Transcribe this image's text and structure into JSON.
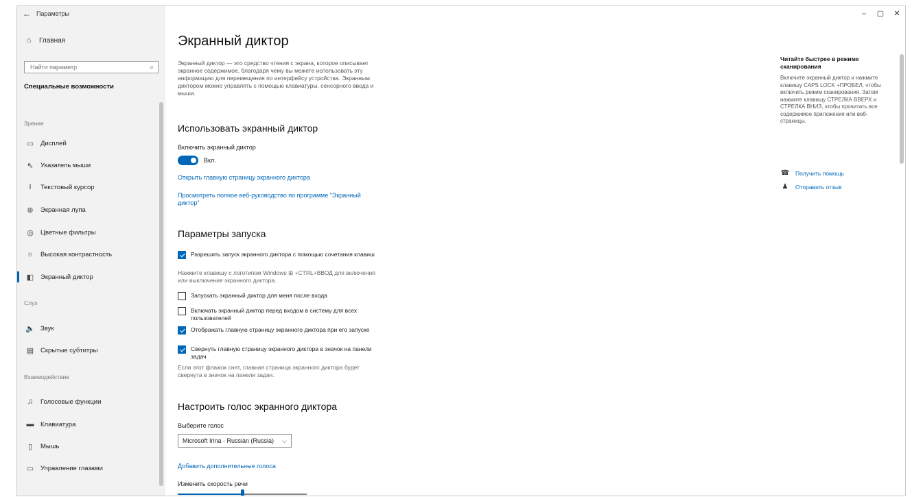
{
  "window": {
    "title": "Параметры",
    "back_icon": "←",
    "minimize": "–",
    "maximize": "▢",
    "close": "✕"
  },
  "sidebar": {
    "home_label": "Главная",
    "search_placeholder": "Найти параметр",
    "section_title": "Специальные возможности",
    "groups": [
      "Зрение",
      "Слух",
      "Взаимодействие"
    ],
    "items": [
      {
        "label": "Дисплей",
        "icon": "display-icon"
      },
      {
        "label": "Указатель мыши",
        "icon": "mouse-pointer-icon"
      },
      {
        "label": "Текстовый курсор",
        "icon": "text-cursor-icon"
      },
      {
        "label": "Экранная лупа",
        "icon": "magnifier-icon"
      },
      {
        "label": "Цветные фильтры",
        "icon": "color-filter-icon"
      },
      {
        "label": "Высокая контрастность",
        "icon": "contrast-icon"
      },
      {
        "label": "Экранный диктор",
        "icon": "narrator-icon"
      },
      {
        "label": "Звук",
        "icon": "speaker-icon"
      },
      {
        "label": "Скрытые субтитры",
        "icon": "captions-icon"
      },
      {
        "label": "Голосовые функции",
        "icon": "microphone-icon"
      },
      {
        "label": "Клавиатура",
        "icon": "keyboard-icon"
      },
      {
        "label": "Мышь",
        "icon": "mouse-icon"
      },
      {
        "label": "Управление глазами",
        "icon": "eye-control-icon"
      }
    ]
  },
  "main": {
    "title": "Экранный диктор",
    "description": "Экранный диктор — это средство чтения с экрана, которое описывает экранное содержимое, благодаря чему вы можете использовать эту информацию для перемещения по интерфейсу устройства. Экранным диктором можно управлять с помощью клавиатуры, сенсорного ввода и мыши.",
    "use_heading": "Использовать экранный диктор",
    "toggle_label": "Включить экранный диктор",
    "toggle_state": "Вкл.",
    "link_home": "Открыть главную страницу экранного диктора",
    "link_guide": "Просмотреть полное веб-руководство по программе \"Экранный диктор\"",
    "startup_heading": "Параметры запуска",
    "checkboxes": [
      {
        "label": "Разрешить запуск экранного диктора с помощью сочетания клавиш",
        "checked": true
      },
      {
        "label": "Запускать экранный диктор для меня после входа",
        "checked": false
      },
      {
        "label": "Включать экранный диктор перед входом в систему для всех пользователей",
        "checked": false
      },
      {
        "label": "Отображать главную страницу экранного диктора при его запуске",
        "checked": true
      },
      {
        "label": "Свернуть главную страницу экранного диктора в значок на панели задач",
        "checked": true
      }
    ],
    "hint_shortcut": "Нажмите клавишу с логотипом Windows ⊞ +CTRL+ВВОД для включения или выключения экранного диктора.",
    "hint_minimize": "Если этот флажок снят, главная страница экранного диктора будет свернута в значок на панели задач.",
    "voice_heading": "Настроить голос экранного диктора",
    "voice_label": "Выберите голос",
    "voice_value": "Microsoft Irina - Russian (Russia)",
    "link_add_voices": "Добавить дополнительные голоса",
    "speed_label": "Изменить скорость речи",
    "speed_value": 0.5
  },
  "aside": {
    "title": "Читайте быстрее в режиме сканирования",
    "text": "Включите экранный диктор и нажмите клавишу CAPS LOCK +ПРОБЕЛ, чтобы включить режим сканирования. Затем нажмите клавишу СТРЕЛКА ВВЕРХ и СТРЕЛКА ВНИЗ, чтобы прочитать все содержимое приложения или веб-страницы.",
    "help_link": "Получить помощь",
    "feedback_link": "Отправить отзыв"
  },
  "colors": {
    "accent": "#0067b8",
    "sidebar_bg": "#f2f2f2"
  }
}
